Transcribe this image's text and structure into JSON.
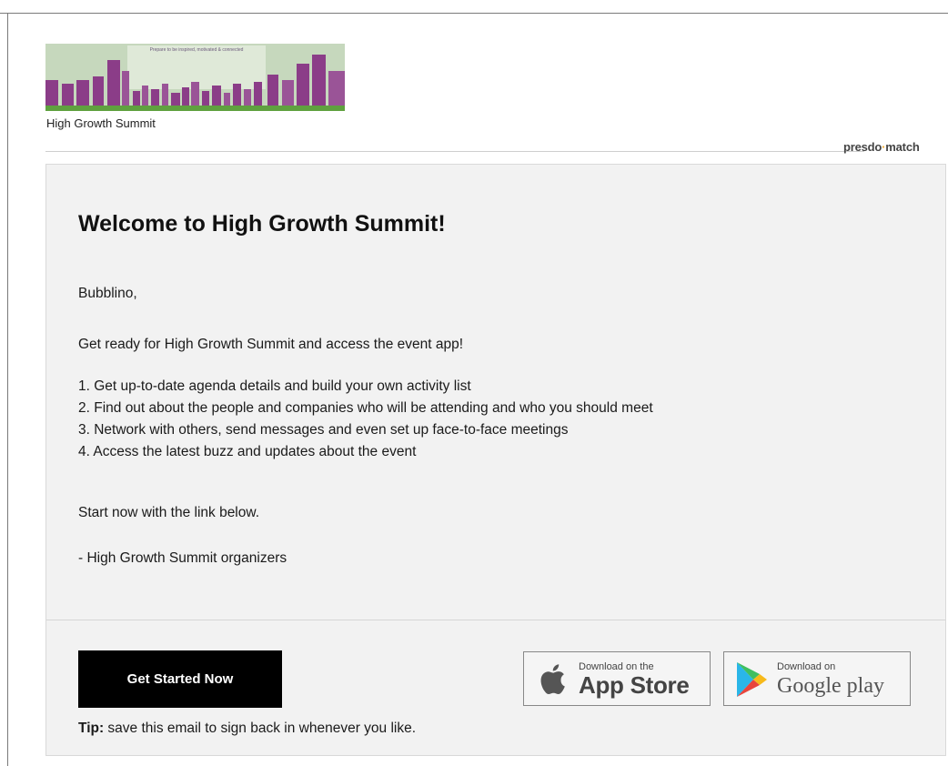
{
  "header": {
    "banner_heading": "Prepare to be inspired, motivated & connected",
    "event_name": "High Growth Summit",
    "brand_left": "presdo",
    "brand_right": "match"
  },
  "email": {
    "title": "Welcome to High Growth Summit!",
    "greeting": "Bubblino,",
    "intro": "Get ready for High Growth Summit and access the event app!",
    "list": [
      "1. Get up-to-date agenda details and build your own activity list",
      "2. Find out about the people and companies who will be attending and who you should meet",
      "3. Network with others, send messages and even set up face-to-face meetings",
      "4. Access the latest buzz and updates about the event"
    ],
    "cta_text": "Start now with the link below.",
    "signature": "- High Growth Summit organizers"
  },
  "footer": {
    "button_label": "Get Started Now",
    "tip_label": "Tip:",
    "tip_text": " save this email to sign back in whenever you like.",
    "app_store": {
      "small": "Download on the",
      "big": "App Store",
      "icon": "apple-icon"
    },
    "google_play": {
      "small": "Download on",
      "big": "Google play",
      "icon": "play-icon"
    }
  },
  "colors": {
    "card_bg": "#f2f2f2",
    "button_bg": "#000000",
    "banner_purple": "#8b3d88",
    "banner_green": "#5fa13f",
    "brand_accent": "#f5a623"
  }
}
